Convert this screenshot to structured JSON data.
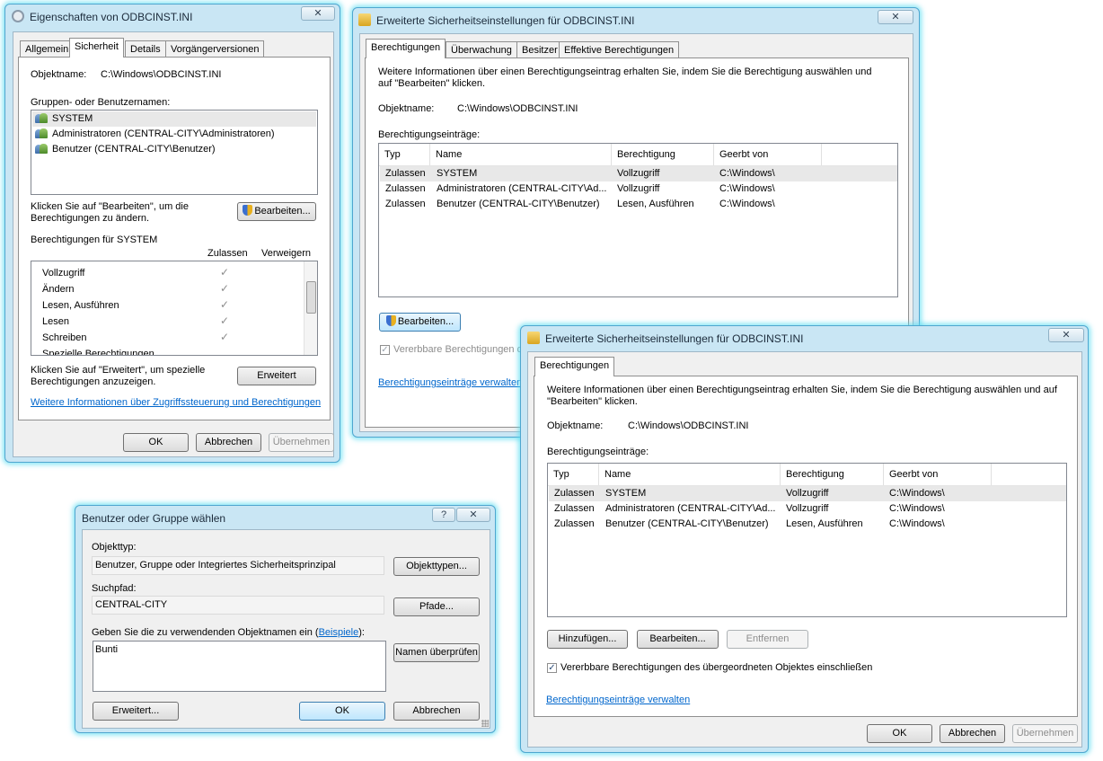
{
  "props_dialog": {
    "title": "Eigenschaften von ODBCINST.INI",
    "tabs": [
      "Allgemein",
      "Sicherheit",
      "Details",
      "Vorgängerversionen"
    ],
    "object_label": "Objektname:",
    "object_value": "C:\\Windows\\ODBCINST.INI",
    "groups_label": "Gruppen- oder Benutzernamen:",
    "groups": [
      "SYSTEM",
      "Administratoren (CENTRAL-CITY\\Administratoren)",
      "Benutzer (CENTRAL-CITY\\Benutzer)"
    ],
    "edit_hint": "Klicken Sie auf \"Bearbeiten\", um die Berechtigungen zu ändern.",
    "edit_button": "Bearbeiten...",
    "perms_for": "Berechtigungen für SYSTEM",
    "col_allow": "Zulassen",
    "col_deny": "Verweigern",
    "perms": [
      "Vollzugriff",
      "Ändern",
      "Lesen, Ausführen",
      "Lesen",
      "Schreiben",
      "Spezielle Berechtigungen"
    ],
    "check_glyph": "✓",
    "advanced_hint": "Klicken Sie auf \"Erweitert\", um spezielle Berechtigungen anzuzeigen.",
    "advanced_button": "Erweitert",
    "info_link": "Weitere Informationen über Zugriffssteuerung und Berechtigungen",
    "ok": "OK",
    "cancel": "Abbrechen",
    "apply": "Übernehmen"
  },
  "adv_dialog": {
    "title": "Erweiterte Sicherheitseinstellungen für ODBCINST.INI",
    "tabs": [
      "Berechtigungen",
      "Überwachung",
      "Besitzer",
      "Effektive Berechtigungen"
    ],
    "info": "Weitere Informationen über einen Berechtigungseintrag erhalten Sie, indem Sie die Berechtigung auswählen und auf \"Bearbeiten\" klicken.",
    "object_label": "Objektname:",
    "object_value": "C:\\Windows\\ODBCINST.INI",
    "entries_label": "Berechtigungseinträge:",
    "columns": [
      "Typ",
      "Name",
      "Berechtigung",
      "Geerbt von"
    ],
    "rows": [
      [
        "Zulassen",
        "SYSTEM",
        "Vollzugriff",
        "C:\\Windows\\"
      ],
      [
        "Zulassen",
        "Administratoren (CENTRAL-CITY\\Ad...",
        "Vollzugriff",
        "C:\\Windows\\"
      ],
      [
        "Zulassen",
        "Benutzer (CENTRAL-CITY\\Benutzer)",
        "Lesen, Ausführen",
        "C:\\Windows\\"
      ]
    ],
    "edit_button": "Bearbeiten...",
    "inherit_label": "Vererbbare Berechtigungen de",
    "manage_link": "Berechtigungseinträge verwalten",
    "checkmark": "✓"
  },
  "adv_edit_dialog": {
    "title": "Erweiterte Sicherheitseinstellungen für ODBCINST.INI",
    "tab": "Berechtigungen",
    "info": "Weitere Informationen über einen Berechtigungseintrag erhalten Sie, indem Sie die Berechtigung auswählen und auf \"Bearbeiten\" klicken.",
    "object_label": "Objektname:",
    "object_value": "C:\\Windows\\ODBCINST.INI",
    "entries_label": "Berechtigungseinträge:",
    "columns": [
      "Typ",
      "Name",
      "Berechtigung",
      "Geerbt von"
    ],
    "rows": [
      [
        "Zulassen",
        "SYSTEM",
        "Vollzugriff",
        "C:\\Windows\\"
      ],
      [
        "Zulassen",
        "Administratoren (CENTRAL-CITY\\Ad...",
        "Vollzugriff",
        "C:\\Windows\\"
      ],
      [
        "Zulassen",
        "Benutzer (CENTRAL-CITY\\Benutzer)",
        "Lesen, Ausführen",
        "C:\\Windows\\"
      ]
    ],
    "add_button": "Hinzufügen...",
    "edit_button": "Bearbeiten...",
    "remove_button": "Entfernen",
    "inherit_label": "Vererbbare Berechtigungen des übergeordneten Objektes einschließen",
    "manage_link": "Berechtigungseinträge verwalten",
    "ok": "OK",
    "cancel": "Abbrechen",
    "apply": "Übernehmen",
    "checkmark": "✓"
  },
  "select_dialog": {
    "title": "Benutzer oder Gruppe wählen",
    "help_glyph": "?",
    "object_type_label": "Objekttyp:",
    "object_type_value": "Benutzer, Gruppe oder Integriertes Sicherheitsprinzipal",
    "object_types_button": "Objekttypen...",
    "location_label": "Suchpfad:",
    "location_value": "CENTRAL-CITY",
    "locations_button": "Pfade...",
    "names_label_pre": "Geben Sie die zu verwendenden Objektnamen ein (",
    "names_link": "Beispiele",
    "names_label_post": "):",
    "names_value": "Bunti",
    "check_names_button": "Namen überprüfen",
    "advanced_button": "Erweitert...",
    "ok": "OK",
    "cancel": "Abbrechen"
  },
  "close_glyph": "✕"
}
